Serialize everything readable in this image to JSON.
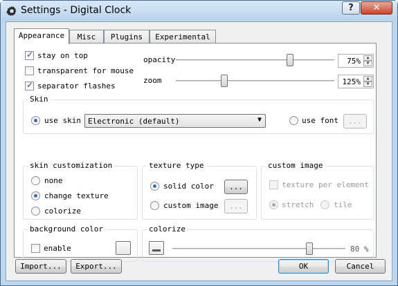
{
  "window": {
    "title": "Settings - Digital Clock",
    "close_glyph": "✕",
    "help_glyph": "?",
    "icon": "gear-icon"
  },
  "tabs": [
    "Appearance",
    "Misc",
    "Plugins",
    "Experimental"
  ],
  "active_tab": "Appearance",
  "general": {
    "stay_on_top": {
      "label": "stay on top",
      "checked": true
    },
    "transparent_for_mouse": {
      "label": "transparent for mouse",
      "checked": false
    },
    "separator_flashes": {
      "label": "separator flashes",
      "checked": true
    },
    "opacity": {
      "label": "opacity",
      "value": "75%",
      "level": 0.75
    },
    "zoom": {
      "label": "zoom",
      "value": "125%"
    }
  },
  "skin": {
    "title": "Skin",
    "use_skin_label": "use skin",
    "selected_skin": "Electronic (default)",
    "use_font_label": "use font",
    "font_button": "..."
  },
  "skin_customization": {
    "title": "skin customization",
    "options": [
      "none",
      "change texture",
      "colorize"
    ],
    "selected": "change texture"
  },
  "texture_type": {
    "title": "texture type",
    "solid_color": "solid color",
    "custom_image": "custom image",
    "solid_button": "...",
    "image_button": "..."
  },
  "custom_image": {
    "title": "custom image",
    "texture_per_element": "texture per element",
    "stretch": "stretch",
    "tile": "tile"
  },
  "background_color": {
    "title": "background color",
    "enable_label": "enable"
  },
  "colorize": {
    "title": "colorize",
    "value": "80 %",
    "level": 0.8
  },
  "footer": {
    "import": "Import...",
    "export": "Export...",
    "ok": "OK",
    "cancel": "Cancel"
  }
}
